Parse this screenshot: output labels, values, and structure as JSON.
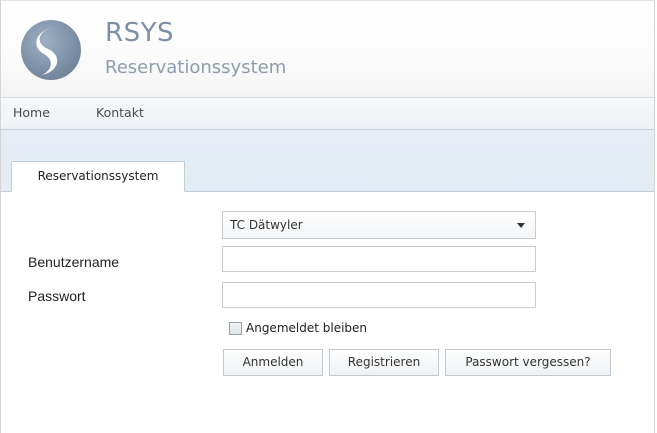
{
  "header": {
    "logo_icon": "rsys-logo-icon",
    "title": "RSYS",
    "subtitle": "Reservationssystem"
  },
  "nav": {
    "items": [
      {
        "label": "Home"
      },
      {
        "label": "Kontakt"
      }
    ]
  },
  "tabs": [
    {
      "label": "Reservationssystem",
      "active": true
    }
  ],
  "login_form": {
    "club_select": {
      "selected": "TC Dätwyler",
      "icon": "chevron-down-icon"
    },
    "username": {
      "label": "Benutzername",
      "value": ""
    },
    "password": {
      "label": "Passwort",
      "value": ""
    },
    "remember_me": {
      "label": "Angemeldet bleiben",
      "checked": false
    },
    "buttons": {
      "login": "Anmelden",
      "register": "Registrieren",
      "forgot_password": "Passwort vergessen?"
    }
  },
  "colors": {
    "brand": "#7d8fa6",
    "nav_background": "#eef2f6",
    "tab_strip_background": "#e4ecf5",
    "border": "#c6ccd4"
  }
}
